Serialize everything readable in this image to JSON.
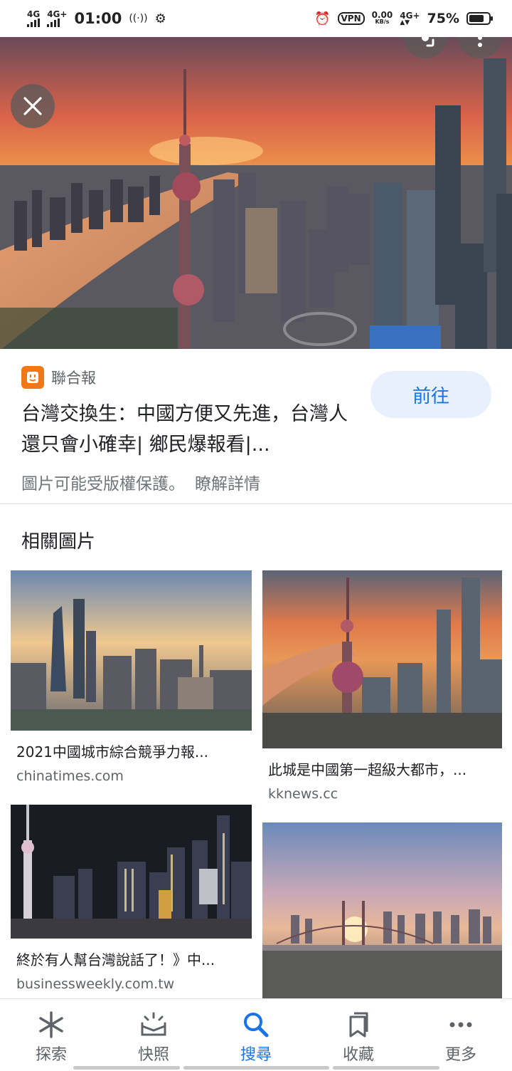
{
  "status_bar": {
    "network_left_1": "4G",
    "network_left_2": "4G+",
    "time": "01:00",
    "vpn": "VPN",
    "speed_value": "0.00",
    "speed_unit": "KB/s",
    "network_right": "4G+",
    "battery": "75%",
    "battery_level": 0.75
  },
  "hero": {
    "close_icon": "close-icon",
    "share_icon": "lens-icon",
    "menu_icon": "more-vert-icon"
  },
  "info": {
    "source_name": "聯合報",
    "headline": "台灣交換生：中國方便又先進，台灣人還只會小確幸| 鄉民爆報看|...",
    "goto_button": "前往",
    "copyright_text": "圖片可能受版權保護。",
    "learn_more": "瞭解詳情"
  },
  "related": {
    "title": "相關圖片",
    "items": [
      {
        "caption": "2021中國城市綜合競爭力報...",
        "site": "chinatimes.com"
      },
      {
        "caption": "此城是中國第一超級大都市，...",
        "site": "kknews.cc"
      },
      {
        "caption": "終於有人幫台灣說話了！》中...",
        "site": "businessweekly.com.tw"
      },
      {
        "caption": "",
        "site": ""
      }
    ]
  },
  "bottom_nav": {
    "items": [
      {
        "label": "探索",
        "icon": "asterisk-icon"
      },
      {
        "label": "快照",
        "icon": "snapshot-icon"
      },
      {
        "label": "搜尋",
        "icon": "search-icon"
      },
      {
        "label": "收藏",
        "icon": "collections-icon"
      },
      {
        "label": "更多",
        "icon": "more-horiz-icon"
      }
    ],
    "active_index": 2
  },
  "colors": {
    "accent": "#1a73e8",
    "goto_bg": "#e8f0fe",
    "source_logo": "#f07818"
  }
}
